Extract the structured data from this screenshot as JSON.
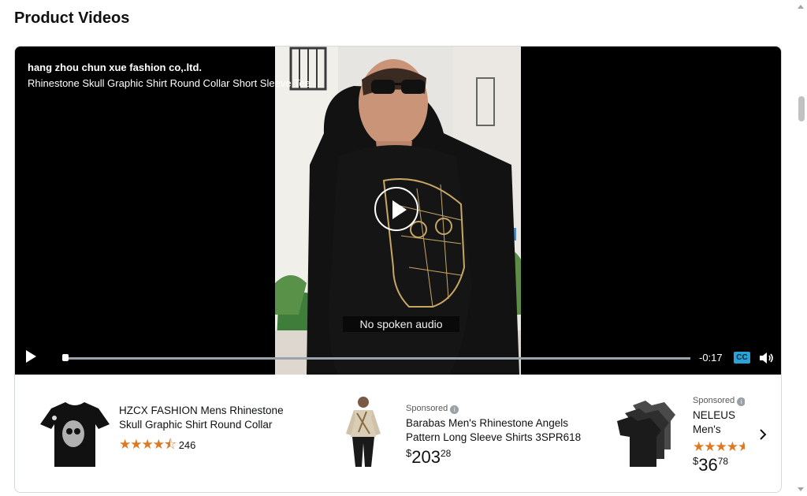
{
  "page": {
    "title": "Product Videos"
  },
  "player": {
    "brand": "hang zhou chun xue fashion co,.ltd.",
    "title": "Rhinestone Skull Graphic Shirt Round Collar Short Sleeve Tee",
    "caption": "No spoken audio",
    "time_remaining": "-0:17",
    "progress_fraction": 0.0,
    "cc_label": "CC"
  },
  "carousel": {
    "items": [
      {
        "name": "HZCX FASHION Mens Rhinestone Skull Graphic Shirt Round Collar Short…",
        "rating": 4.5,
        "rating_count": "246"
      },
      {
        "sponsored": "Sponsored",
        "name": "Barabas Men's Rhinestone Angels Pattern Long Sleeve Shirts 3SPR618",
        "price_symbol": "$",
        "price_whole": "203",
        "price_fraction": "28"
      },
      {
        "sponsored": "Sponsored",
        "name": "NELEUS Men's Athletic Shirts",
        "rating": 4.5,
        "price_symbol": "$",
        "price_whole": "36",
        "price_fraction": "78"
      }
    ]
  },
  "colors": {
    "star": "#de7921",
    "cc": "#2aa4d6",
    "player_bg": "#000000"
  }
}
